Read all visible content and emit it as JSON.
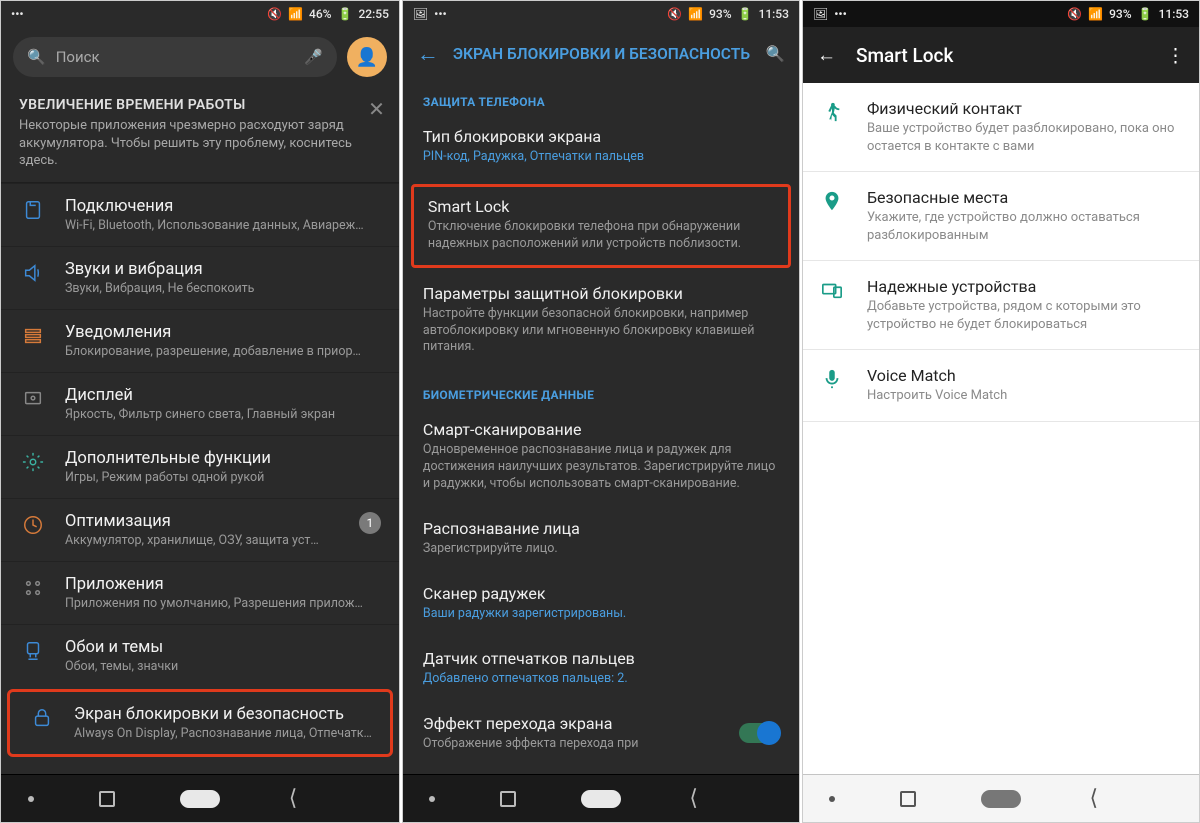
{
  "phone1": {
    "status": {
      "battery": "46%",
      "time": "22:55"
    },
    "search_placeholder": "Поиск",
    "tip": {
      "title": "УВЕЛИЧЕНИЕ ВРЕМЕНИ РАБОТЫ",
      "body": "Некоторые приложения чрезмерно расходуют заряд аккумулятора. Чтобы решить эту проблему, коснитесь здесь."
    },
    "items": [
      {
        "title": "Подключения",
        "sub": "Wi-Fi, Bluetooth, Использование данных, Авиареж…"
      },
      {
        "title": "Звуки и вибрация",
        "sub": "Звуки, Вибрация, Не беспокоить"
      },
      {
        "title": "Уведомления",
        "sub": "Блокирование, разрешение, добавление в приор…"
      },
      {
        "title": "Дисплей",
        "sub": "Яркость, Фильтр синего света, Главный экран"
      },
      {
        "title": "Дополнительные функции",
        "sub": "Игры, Режим работы одной рукой"
      },
      {
        "title": "Оптимизация",
        "sub": "Аккумулятор, хранилище, ОЗУ, защита уст…",
        "badge": "1"
      },
      {
        "title": "Приложения",
        "sub": "Приложения по умолчанию, Разрешения прилож…"
      },
      {
        "title": "Обои и темы",
        "sub": "Обои, темы, значки"
      },
      {
        "title": "Экран блокировки и безопасность",
        "sub": "Always On Display, Распознавание лица, Отпечатк…",
        "highlight": true
      }
    ]
  },
  "phone2": {
    "status": {
      "battery": "93%",
      "time": "11:53"
    },
    "header": "ЭКРАН БЛОКИРОВКИ И БЕЗОПАСНОСТЬ",
    "section1": "ЗАЩИТА ТЕЛЕФОНА",
    "items1": [
      {
        "title": "Тип блокировки экрана",
        "sub": "PIN-код, Радужка, Отпечатки пальцев",
        "link": true
      },
      {
        "title": "Smart Lock",
        "sub": "Отключение блокировки телефона при обнаружении надежных расположений или устройств поблизости.",
        "highlight": true
      },
      {
        "title": "Параметры защитной блокировки",
        "sub": "Настройте функции безопасной блокировки, например автоблокировку или мгновенную блокировку клавишей питания."
      }
    ],
    "section2": "БИОМЕТРИЧЕСКИЕ ДАННЫЕ",
    "items2": [
      {
        "title": "Смарт-сканирование",
        "sub": "Одновременное распознавание лица и радужек для достижения наилучших результатов. Зарегистрируйте лицо и радужки, чтобы использовать смарт-сканирование."
      },
      {
        "title": "Распознавание лица",
        "sub": "Зарегистрируйте лицо."
      },
      {
        "title": "Сканер радужек",
        "sub": "Ваши радужки зарегистрированы.",
        "link": true
      },
      {
        "title": "Датчик отпечатков пальцев",
        "sub": "Добавлено отпечатков пальцев: 2.",
        "link": true
      },
      {
        "title": "Эффект перехода экрана",
        "sub": "Отображение эффекта перехода при",
        "toggle": true
      }
    ]
  },
  "phone3": {
    "status": {
      "battery": "93%",
      "time": "11:53"
    },
    "header": "Smart Lock",
    "items": [
      {
        "title": "Физический контакт",
        "sub": "Ваше устройство будет разблокировано, пока оно остается в контакте с вами"
      },
      {
        "title": "Безопасные места",
        "sub": "Укажите, где устройство должно оставаться разблокированным"
      },
      {
        "title": "Надежные устройства",
        "sub": "Добавьте устройства, рядом с которыми это устройство не будет блокироваться"
      },
      {
        "title": "Voice Match",
        "sub": "Настроить Voice Match"
      }
    ]
  }
}
